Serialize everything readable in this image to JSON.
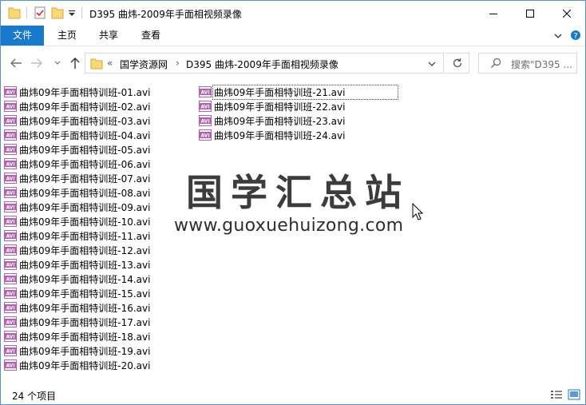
{
  "window": {
    "title": "D395 曲炜-2009年手面相视频录像"
  },
  "ribbon": {
    "tabs": [
      "文件",
      "主页",
      "共享",
      "查看"
    ]
  },
  "address": {
    "overflow": "«",
    "segments": [
      "国学资源网",
      "D395 曲炜-2009年手面相视频录像"
    ],
    "search_placeholder": "搜索\"D395 ..."
  },
  "files": [
    "曲炜09年手面相特训班-01.avi",
    "曲炜09年手面相特训班-02.avi",
    "曲炜09年手面相特训班-03.avi",
    "曲炜09年手面相特训班-04.avi",
    "曲炜09年手面相特训班-05.avi",
    "曲炜09年手面相特训班-06.avi",
    "曲炜09年手面相特训班-07.avi",
    "曲炜09年手面相特训班-08.avi",
    "曲炜09年手面相特训班-09.avi",
    "曲炜09年手面相特训班-10.avi",
    "曲炜09年手面相特训班-11.avi",
    "曲炜09年手面相特训班-12.avi",
    "曲炜09年手面相特训班-13.avi",
    "曲炜09年手面相特训班-14.avi",
    "曲炜09年手面相特训班-15.avi",
    "曲炜09年手面相特训班-16.avi",
    "曲炜09年手面相特训班-17.avi",
    "曲炜09年手面相特训班-18.avi",
    "曲炜09年手面相特训班-19.avi",
    "曲炜09年手面相特训班-20.avi",
    "曲炜09年手面相特训班-21.avi",
    "曲炜09年手面相特训班-22.avi",
    "曲炜09年手面相特训班-23.avi",
    "曲炜09年手面相特训班-24.avi"
  ],
  "file_icon_label": "AVI",
  "focused_file_index": 20,
  "watermark": {
    "title": "国学汇总站",
    "url": "www.guoxuehuizong.com"
  },
  "status": {
    "item_count": "24 个项目"
  },
  "colors": {
    "accent": "#1979ca",
    "folder": "#f8d775",
    "avi_icon": "#b45fb0"
  }
}
